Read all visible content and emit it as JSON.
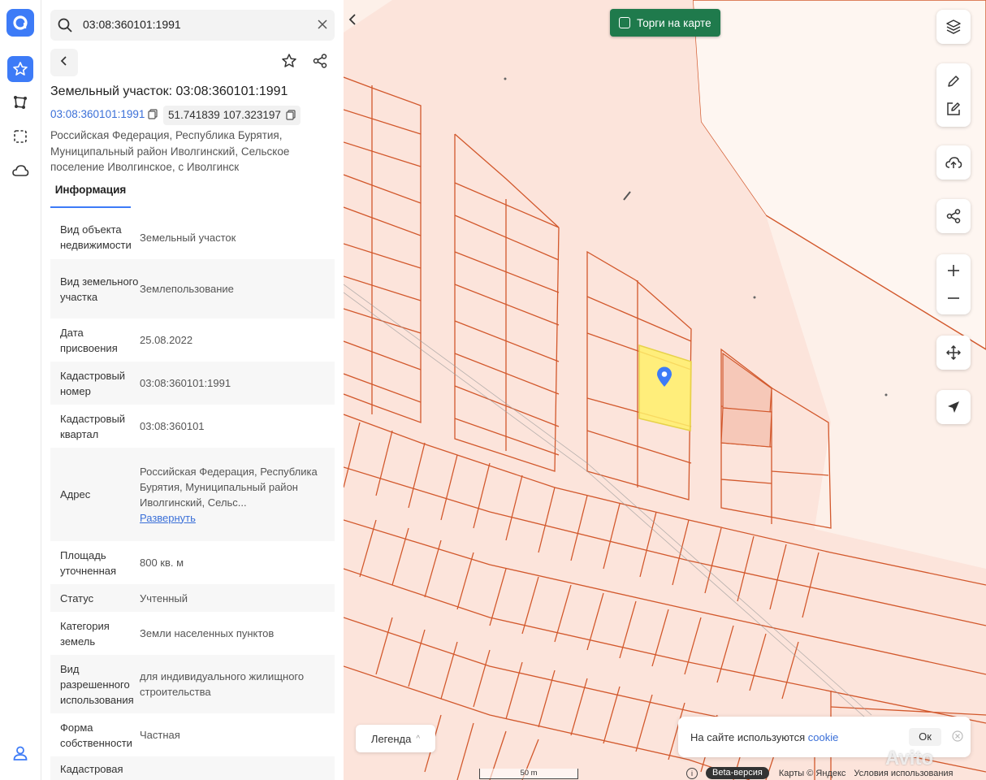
{
  "search": {
    "value": "03:08:360101:1991"
  },
  "object": {
    "title": "Земельный участок: 03:08:360101:1991",
    "cad_number": "03:08:360101:1991",
    "coords": "51.741839 107.323197",
    "address": "Российская Федерация, Республика Бурятия, Муниципальный район Иволгинский, Сельское поселение Иволгинское, с Иволгинск"
  },
  "tabs": {
    "info": "Информация"
  },
  "info_rows": [
    {
      "key": "Вид объекта недвижимости",
      "value": "Земельный участок"
    },
    {
      "key": "Вид земельного участка",
      "value": "Землепользование"
    },
    {
      "key": "Дата присвоения",
      "value": "25.08.2022"
    },
    {
      "key": "Кадастровый номер",
      "value": "03:08:360101:1991"
    },
    {
      "key": "Кадастровый квартал",
      "value": "03:08:360101"
    },
    {
      "key": "Адрес",
      "value": "Российская Федерация, Республика Бурятия, Муниципальный район Иволгинский, Сельс...",
      "more": "Развернуть"
    },
    {
      "key": "Площадь уточненная",
      "value": "800 кв. м"
    },
    {
      "key": "Статус",
      "value": "Учтенный"
    },
    {
      "key": "Категория земель",
      "value": "Земли населенных пунктов"
    },
    {
      "key": "Вид разрешенного использования",
      "value": "для индивидуального жилищного строительства"
    },
    {
      "key": "Форма собственности",
      "value": "Частная"
    },
    {
      "key": "Кадастровая",
      "value": ""
    }
  ],
  "map": {
    "torgi_label": "Торги на карте",
    "legend_label": "Легенда",
    "scale_label": "50 m",
    "cookie_text": "На сайте используются",
    "cookie_link": "cookie",
    "cookie_ok": "Ок",
    "footer_beta": "Beta-версия",
    "footer_maps": "Карты © Яндекс",
    "footer_terms": "Условия использования",
    "watermark": "Avito"
  },
  "colors": {
    "accent": "#3d7bf7",
    "torgi": "#1f7a4c",
    "parcel_line": "#d2582c",
    "parcel_fill": "#fce4db",
    "selected": "#fff06a"
  },
  "icons": [
    "logo-icon",
    "star-icon",
    "route-icon",
    "select-area-icon",
    "cloud-icon",
    "profile-icon",
    "search-icon",
    "close-icon",
    "back-icon",
    "share-icon",
    "copy-icon",
    "layers-icon",
    "pencil-icon",
    "edit-icon",
    "upload-cloud-icon",
    "share-map-icon",
    "plus-icon",
    "minus-icon",
    "move-icon",
    "locate-icon",
    "pin-icon"
  ]
}
